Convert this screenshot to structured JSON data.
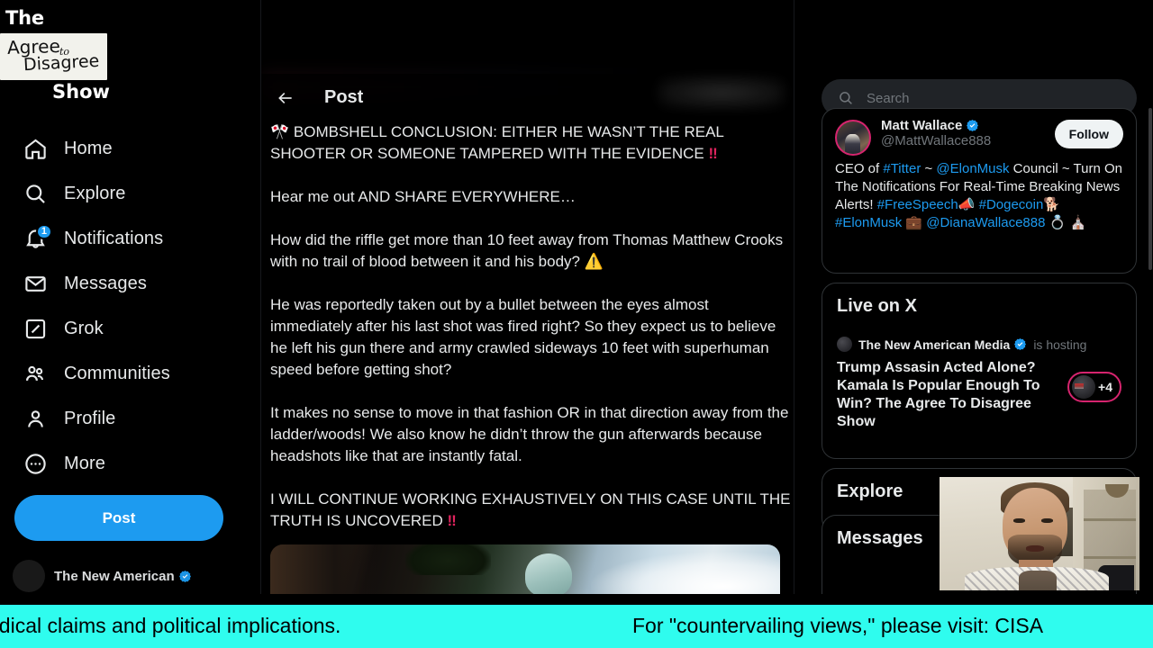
{
  "overlay_logo": {
    "line1": "The",
    "plate_word1": "Agree",
    "plate_to": "to",
    "plate_word2": "Disagree",
    "line3": "Show"
  },
  "sidebar": {
    "items": [
      {
        "label": "Home",
        "icon": "home-icon",
        "badge": null
      },
      {
        "label": "Explore",
        "icon": "search-icon",
        "badge": null
      },
      {
        "label": "Notifications",
        "icon": "bell-icon",
        "badge": "1"
      },
      {
        "label": "Messages",
        "icon": "envelope-icon",
        "badge": null
      },
      {
        "label": "Grok",
        "icon": "grok-icon",
        "badge": null
      },
      {
        "label": "Communities",
        "icon": "people-icon",
        "badge": null
      },
      {
        "label": "Profile",
        "icon": "person-icon",
        "badge": null
      },
      {
        "label": "More",
        "icon": "more-circle-icon",
        "badge": null
      }
    ],
    "post_button": "Post",
    "account": {
      "name": "The New American"
    }
  },
  "center": {
    "back_label": "Back",
    "title": "Post",
    "paragraphs": [
      "🎌 BOMBSHELL CONCLUSION: EITHER HE WASN’T THE REAL SHOOTER OR SOMEONE TAMPERED WITH THE EVIDENCE ‼️",
      "Hear me out AND SHARE EVERYWHERE…",
      "How did the riffle get more than 10 feet away from Thomas Matthew Crooks with no trail of blood between it and his body? ⚠️",
      "He was reportedly taken out by a bullet between the eyes almost immediately after his last shot was fired right? So they expect us to believe he left his gun there and army crawled sideways 10 feet with superhuman speed before getting shot?",
      "It makes no sense to move in that fashion OR in that direction away from the ladder/woods! We also know he didn’t throw the gun afterwards because headshots like that are instantly fatal.",
      "I WILL CONTINUE WORKING EXHAUSTIVELY ON THIS CASE UNTIL THE TRUTH IS UNCOVERED ‼️"
    ],
    "media_alt": "attached photo"
  },
  "search": {
    "placeholder": "Search",
    "value": ""
  },
  "profile_card": {
    "name": "Matt Wallace",
    "verified": true,
    "handle": "@MattWallace888",
    "follow_label": "Follow",
    "bio_parts": [
      {
        "text": "CEO of ",
        "link": false
      },
      {
        "text": "#Titter",
        "link": true
      },
      {
        "text": " ~ ",
        "link": false
      },
      {
        "text": "@ElonMusk",
        "link": true
      },
      {
        "text": " Council ~ Turn On The Notifications For Real-Time Breaking News Alerts! ",
        "link": false
      },
      {
        "text": "#FreeSpeech",
        "link": true
      },
      {
        "text": "📣 ",
        "link": false
      },
      {
        "text": "#Dogecoin",
        "link": true
      },
      {
        "text": "🐕 ",
        "link": false
      },
      {
        "text": "#ElonMusk",
        "link": true
      },
      {
        "text": " 💼 ",
        "link": false
      },
      {
        "text": "@DianaWallace888",
        "link": true
      },
      {
        "text": " 💍 ⛪",
        "link": false
      }
    ]
  },
  "live_on_x": {
    "panel_title": "Live on X",
    "host_name": "The New American Media",
    "host_verified": true,
    "host_suffix": "is hosting",
    "space_title": "Trump Assasin Acted Alone? Kamala Is Popular Enough To Win? The Agree To Disagree Show",
    "listener_count": "+4"
  },
  "explore_panel": {
    "title": "Explore"
  },
  "messages_panel": {
    "title": "Messages"
  },
  "ticker": {
    "segment_left": "edical claims and political implications.",
    "segment_right": "For \"countervailing views,\" please visit: CISA",
    "background_color": "#2ffcee",
    "text_color": "#000000"
  },
  "colors": {
    "accent_blue": "#1d9bf0",
    "verified_blue": "#1d9bf0",
    "alert_red": "#e0245e",
    "live_pink": "#d6246e",
    "page_background": "#000000",
    "panel_border": "#2f3336",
    "muted_text": "#71767b",
    "primary_text": "#e7e9ea"
  }
}
